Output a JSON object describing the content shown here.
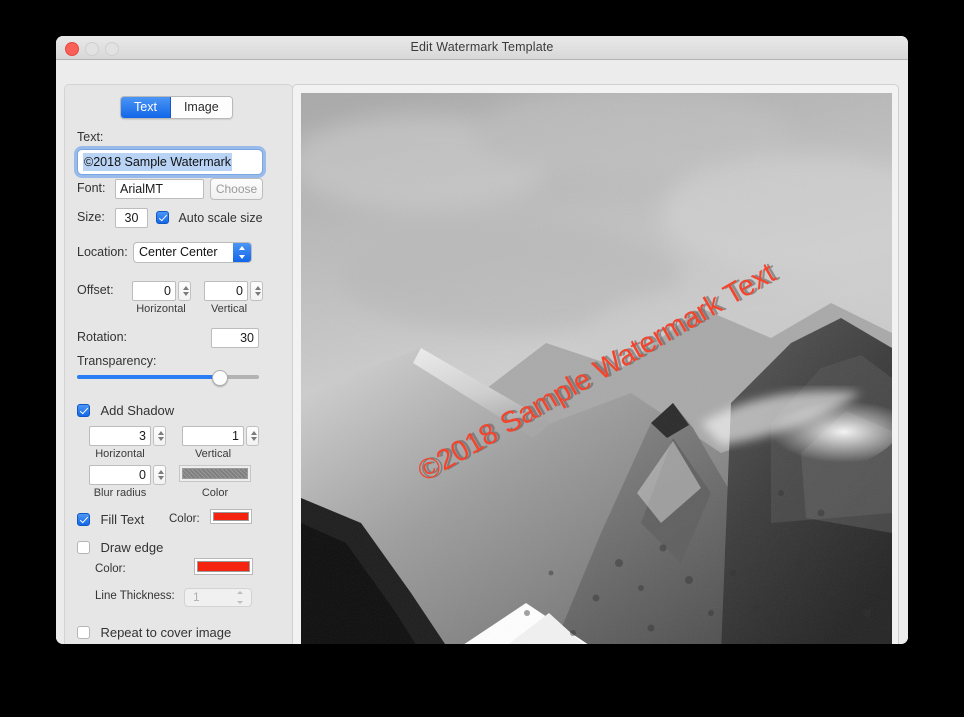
{
  "window": {
    "title": "Edit Watermark Template",
    "traffic_lights": [
      "close",
      "minimize",
      "maximize"
    ]
  },
  "tabs": [
    {
      "label": "Text",
      "active": true
    },
    {
      "label": "Image",
      "active": false
    }
  ],
  "form": {
    "text_label": "Text:",
    "text_value": "©2018 Sample Watermark",
    "font_label": "Font:",
    "font_value": "ArialMT",
    "choose_label": "Choose",
    "size_label": "Size:",
    "size_value": "30",
    "auto_scale_label": "Auto scale size",
    "auto_scale_checked": true,
    "location_label": "Location:",
    "location_value": "Center Center",
    "offset_label": "Offset:",
    "offset_horizontal_value": "0",
    "offset_horizontal_caption": "Horizontal",
    "offset_vertical_value": "0",
    "offset_vertical_caption": "Vertical",
    "rotation_label": "Rotation:",
    "rotation_value": "30",
    "transparency_label": "Transparency:",
    "transparency_percent": 78,
    "shadow_label": "Add Shadow",
    "shadow_checked": true,
    "shadow_horizontal_value": "3",
    "shadow_horizontal_caption": "Horizontal",
    "shadow_vertical_value": "1",
    "shadow_vertical_caption": "Vertical",
    "shadow_blur_value": "0",
    "shadow_blur_caption": "Blur radius",
    "shadow_color_caption": "Color",
    "shadow_color": "#7f7f7f",
    "fill_text_label": "Fill Text",
    "fill_text_checked": true,
    "fill_color_label": "Color:",
    "fill_color": "#f42410",
    "draw_edge_label": "Draw edge",
    "draw_edge_checked": false,
    "edge_color_label": "Color:",
    "edge_color": "#f42410",
    "line_thickness_label": "Line Thickness:",
    "line_thickness_value": "1",
    "repeat_label": "Repeat to cover image",
    "repeat_checked": false
  },
  "preview": {
    "watermark_text": "©2018 Sample Watermark Text",
    "watermark_color": "#f4442c",
    "watermark_rotation_deg": -30,
    "image_description": "grayscale mountain landscape"
  }
}
